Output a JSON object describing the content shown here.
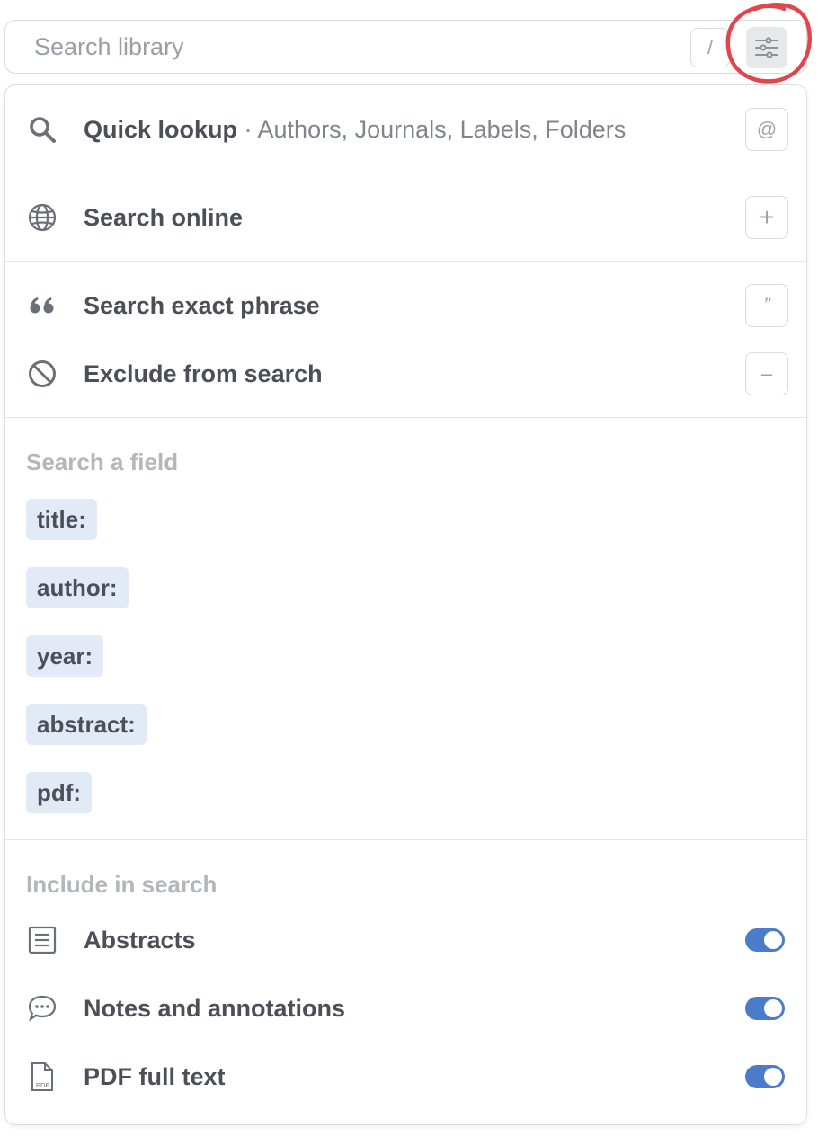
{
  "search": {
    "placeholder": "Search library",
    "shortcut": "/",
    "filter_icon": "sliders-icon"
  },
  "quick_lookup": {
    "label": "Quick lookup",
    "sub": " · Authors, Journals, Labels, Folders",
    "shortcut": "@",
    "icon": "magnifier-icon"
  },
  "search_online": {
    "label": "Search online",
    "shortcut": "+",
    "icon": "globe-icon"
  },
  "exact_phrase": {
    "label": "Search exact phrase",
    "shortcut": "”",
    "icon": "quote-icon"
  },
  "exclude": {
    "label": "Exclude from search",
    "shortcut": "–",
    "icon": "ban-icon"
  },
  "fields": {
    "heading": "Search a field",
    "items": [
      "title:",
      "author:",
      "year:",
      "abstract:",
      "pdf:"
    ]
  },
  "include": {
    "heading": "Include in search",
    "items": [
      {
        "label": "Abstracts",
        "icon": "document-lines-icon",
        "enabled": true
      },
      {
        "label": "Notes and annotations",
        "icon": "speech-bubble-icon",
        "enabled": true
      },
      {
        "label": "PDF full text",
        "icon": "pdf-file-icon",
        "enabled": true
      }
    ]
  },
  "colors": {
    "accent": "#4a7cc9",
    "chip_bg": "#e2eaf6",
    "highlight_circle": "#e0474c"
  }
}
